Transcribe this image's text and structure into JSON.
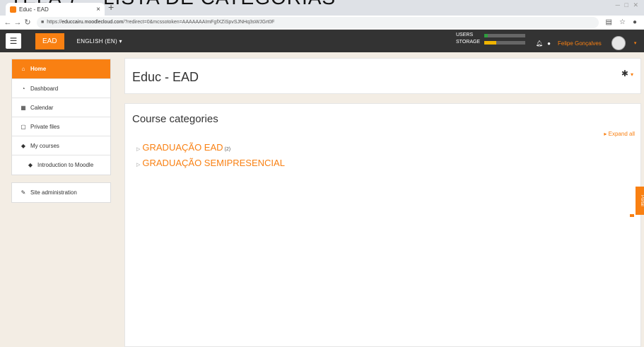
{
  "browser": {
    "tab_title": "Educ - EAD",
    "tab_close": "×",
    "new_tab": "+",
    "url_domain": "educcairu.moodlecloud.com",
    "url_prefix": "https://",
    "url_path": "/?redirect=0&mcssotoken=AAAAAAAImFgfXZiSpvSJNHq3sWJGrt0F"
  },
  "navbar": {
    "brand": "EAD",
    "language": "ENGLISH (EN) ▾",
    "usage": [
      {
        "label": "USERS",
        "fraction": 0.08,
        "color": "#2e9e3e"
      },
      {
        "label": "STORAGE",
        "fraction": 0.3,
        "color": "#f0b400"
      }
    ],
    "user_name": "Felipe Gonçalves"
  },
  "sidebar": {
    "main_items": [
      {
        "label": "Home",
        "icon": "home-icon",
        "glyph": "⌂",
        "active": true
      },
      {
        "label": "Dashboard",
        "icon": "dashboard-icon",
        "glyph": "◔"
      },
      {
        "label": "Calendar",
        "icon": "calendar-icon",
        "glyph": "▦"
      },
      {
        "label": "Private files",
        "icon": "file-icon",
        "glyph": "▢"
      },
      {
        "label": "My courses",
        "icon": "graduation-cap-icon",
        "glyph": "◆"
      },
      {
        "label": "Introduction to Moodle",
        "icon": "graduation-cap-icon",
        "glyph": "◆",
        "indent": true
      }
    ],
    "admin_item": {
      "label": "Site administration",
      "icon": "wrench-icon",
      "glyph": "✎"
    }
  },
  "header": {
    "title": "Educ - EAD"
  },
  "main": {
    "heading": "Course categories",
    "expand_all": "Expand all",
    "categories": [
      {
        "label": "GRADUAÇÃO EAD",
        "suffix": "(2)"
      },
      {
        "label": "GRADUAÇÃO SEMIPRESENCIAL",
        "suffix": ""
      }
    ]
  },
  "side_widget": {
    "label": "Portal"
  }
}
